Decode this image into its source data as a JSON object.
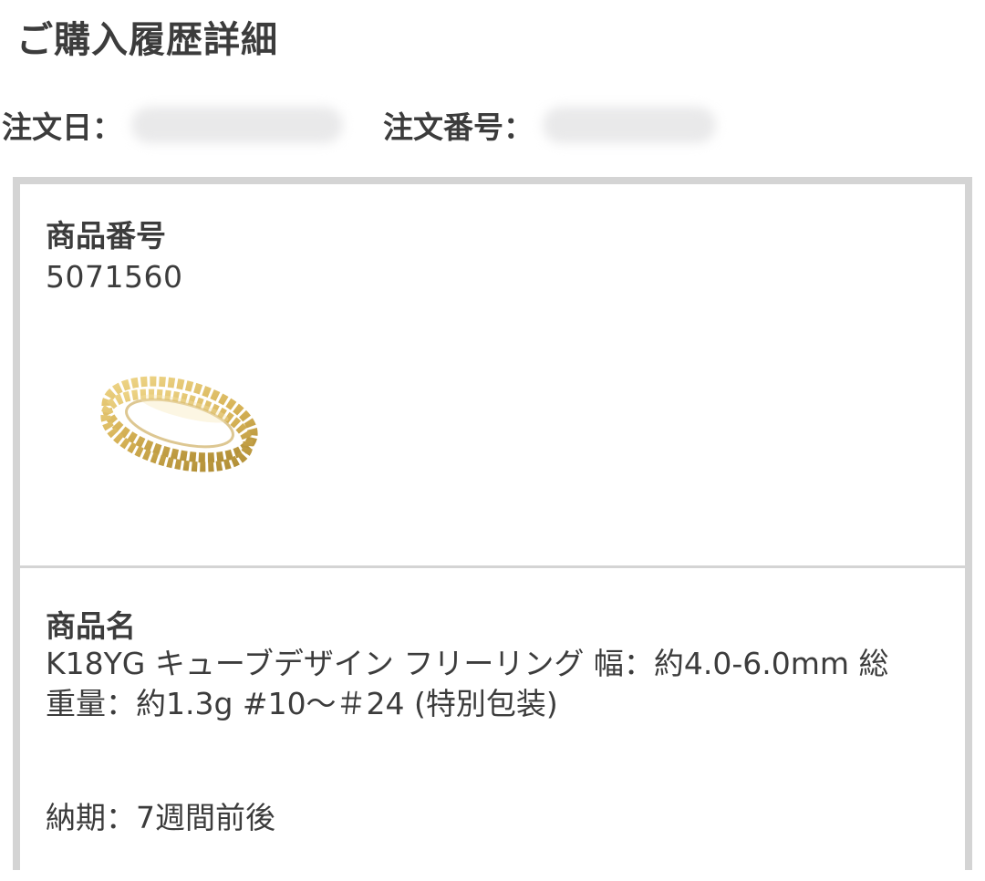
{
  "header": {
    "title": "ご購入履歴詳細"
  },
  "order_meta": {
    "date_label": "注文日：",
    "number_label": "注文番号："
  },
  "product": {
    "number_label": "商品番号",
    "number_value": "5071560",
    "name_label": "商品名",
    "name_value": "K18YG キューブデザイン フリーリング 幅：約4.0-6.0mm 総重量：約1.3g #10〜＃24 (特別包装)",
    "delivery": "納期：7週間前後"
  },
  "colors": {
    "border": "#d4d4d4",
    "text": "#3c3c3c",
    "ring_gold": "#d9b960"
  },
  "icons": {
    "product_image": "gold-ring-image"
  }
}
